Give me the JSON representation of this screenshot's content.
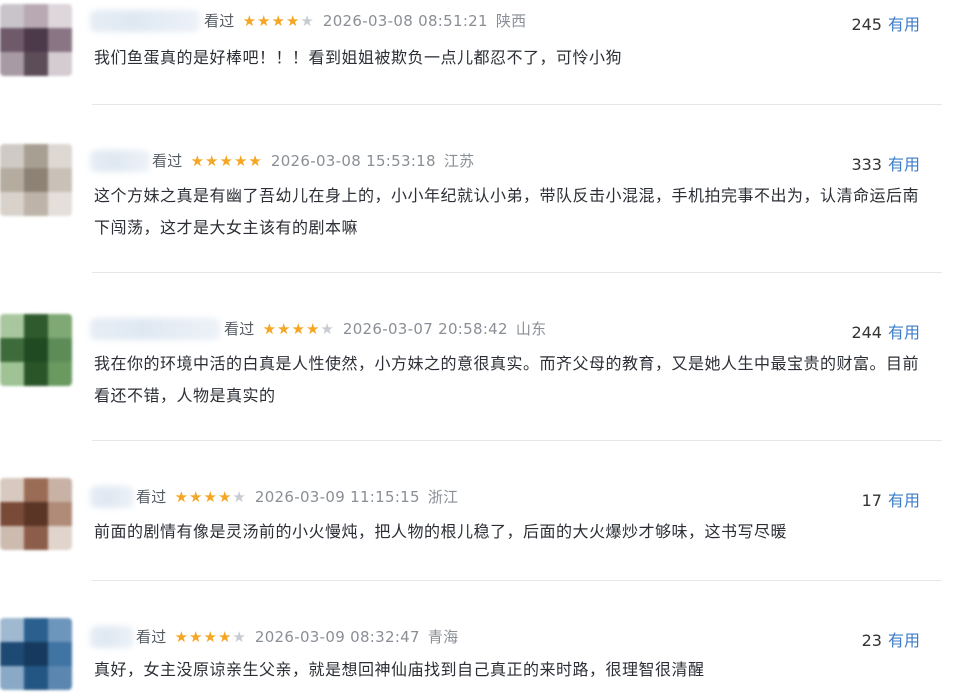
{
  "reviews": [
    {
      "user_suffix": "看过",
      "rating": 4,
      "date": "2026-03-08 08:51:21",
      "location": "陕西",
      "useful_count": "245",
      "useful_label": "有用",
      "text": "我们鱼蛋真的是好棒吧！！！看到姐姐被欺负一点儿都忍不了，可怜小狗",
      "avatar_colors": [
        "#c9c4c9",
        "#b8a9b3",
        "#ddd6db",
        "#6e5a6a",
        "#4c3a4a",
        "#8a7585",
        "#a89aa4",
        "#5d4d59",
        "#d4ccd1"
      ]
    },
    {
      "user_suffix": "看过",
      "rating": 5,
      "date": "2026-03-08 15:53:18",
      "location": "江苏",
      "useful_count": "333",
      "useful_label": "有用",
      "text": "这个方妹之真是有幽了吾幼儿在身上的，小小年纪就认小弟，带队反击小混混，手机拍完事不出为，认清命运后南下闯荡，这才是大女主该有的剧本嘛",
      "avatar_colors": [
        "#cfcac4",
        "#a89f93",
        "#ddd8d2",
        "#b5ab9f",
        "#8e8275",
        "#c9c1b7",
        "#d8d2cb",
        "#bdb3a8",
        "#e4dfda"
      ]
    },
    {
      "user_suffix": "看过",
      "rating": 4,
      "date": "2026-03-07 20:58:42",
      "location": "山东",
      "useful_count": "244",
      "useful_label": "有用",
      "text": "我在你的环境中活的白真是人性使然，小方妹之的意很真实。而齐父母的教育，又是她人生中最宝贵的财富。目前看还不错，人物是真实的",
      "avatar_colors": [
        "#a9c79e",
        "#2f5a2e",
        "#7fa874",
        "#3d6b3a",
        "#1f4a22",
        "#5e8c57",
        "#9fc394",
        "#2a5529",
        "#6a9a60"
      ]
    },
    {
      "user_suffix": "看过",
      "rating": 4,
      "date": "2026-03-09 11:15:15",
      "location": "浙江",
      "useful_count": "17",
      "useful_label": "有用",
      "text": "前面的剧情有像是灵汤前的小火慢炖，把人物的根儿稳了，后面的大火爆炒才够味，这书写尽暖",
      "avatar_colors": [
        "#d8c9c0",
        "#9a6b55",
        "#c8b2a5",
        "#7a4a38",
        "#5a3526",
        "#b08b78",
        "#cdbbb0",
        "#8c5e4a",
        "#e0d4cc"
      ]
    },
    {
      "user_suffix": "看过",
      "rating": 4,
      "date": "2026-03-09 08:32:47",
      "location": "青海",
      "useful_count": "23",
      "useful_label": "有用",
      "text": "真好，女主没原谅亲生父亲，就是想回神仙庙找到自己真正的来时路，很理智很清醒",
      "avatar_colors": [
        "#9fb9d1",
        "#2a5f8e",
        "#6e95bb",
        "#1d4a74",
        "#163a5e",
        "#3f74a3",
        "#8aa9c6",
        "#245684",
        "#5a86b0"
      ]
    }
  ]
}
